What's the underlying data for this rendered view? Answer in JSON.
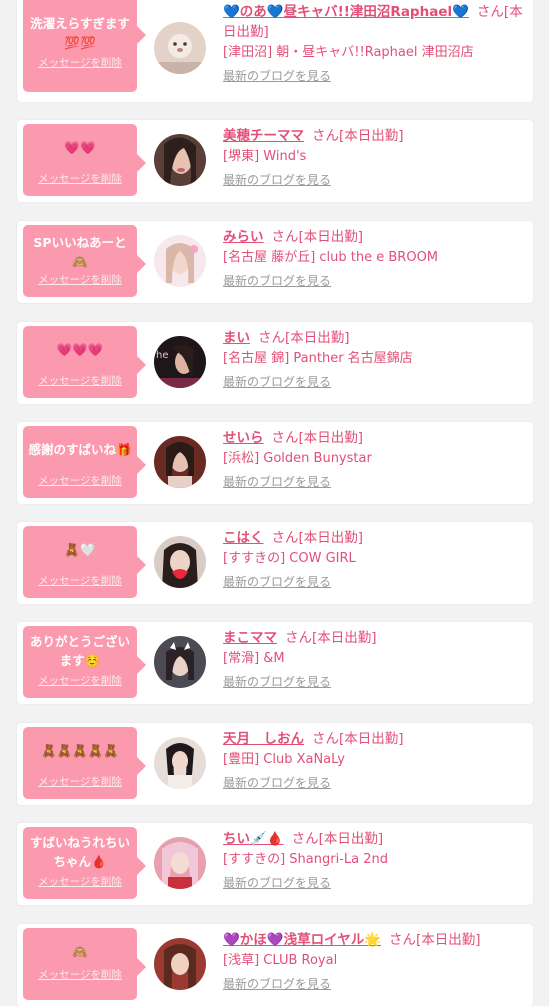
{
  "entries": [
    {
      "message": "洗濯えらすぎます💯💯",
      "delete_label": "メッセージを削除",
      "name": "💙のあ💙昼キャバ!!津田沼Raphael💙",
      "suffix": "さん[本日出勤]",
      "shop": "[津田沼] 朝・昼キャバ!!Raphael 津田沼店",
      "blog_link": "最新のブログを見る",
      "avatar_color": "#d9c6bc"
    },
    {
      "message": "💗💗",
      "delete_label": "メッセージを削除",
      "name": "美穂チーママ",
      "suffix": "さん[本日出勤]",
      "shop": "[堺東] Wind's",
      "blog_link": "最新のブログを見る",
      "avatar_color": "#8a6a5c"
    },
    {
      "message": "SPいいねあーと🙈",
      "delete_label": "メッセージを削除",
      "name": "みらい",
      "suffix": "さん[本日出勤]",
      "shop": "[名古屋 藤が丘] club the e BROOM",
      "blog_link": "最新のブログを見る",
      "avatar_color": "#f3dfe6"
    },
    {
      "message": "💗💗💗",
      "delete_label": "メッセージを削除",
      "name": "まい",
      "suffix": "さん[本日出勤]",
      "shop": "[名古屋 錦] Panther 名古屋錦店",
      "blog_link": "最新のブログを見る",
      "avatar_color": "#3a2a2e"
    },
    {
      "message": "感謝のすばいね🎁",
      "delete_label": "メッセージを削除",
      "name": "せいら",
      "suffix": "さん[本日出勤]",
      "shop": "[浜松] Golden Bunystar",
      "blog_link": "最新のブログを見る",
      "avatar_color": "#7a3a30"
    },
    {
      "message": "🧸🤍",
      "delete_label": "メッセージを削除",
      "name": "こはく",
      "suffix": "さん[本日出勤]",
      "shop": "[すすきの] COW GIRL",
      "blog_link": "最新のブログを見る",
      "avatar_color": "#4a3a34"
    },
    {
      "message": "ありがとうございます☺️",
      "delete_label": "メッセージを削除",
      "name": "まこママ",
      "suffix": "さん[本日出勤]",
      "shop": "[常滑] &M",
      "blog_link": "最新のブログを見る",
      "avatar_color": "#5b5660"
    },
    {
      "message": "🧸🧸🧸🧸🧸",
      "delete_label": "メッセージを削除",
      "name": "天月　しおん",
      "suffix": "さん[本日出勤]",
      "shop": "[豊田] Club XaNaLy",
      "blog_link": "最新のブログを見る",
      "avatar_color": "#d8ccc8"
    },
    {
      "message": "すばいねうれちいちゃん🩸",
      "delete_label": "メッセージを削除",
      "name": "ちい💉🩸",
      "suffix": "さん[本日出勤]",
      "shop": "[すすきの] Shangri-La 2nd",
      "blog_link": "最新のブログを見る",
      "avatar_color": "#d98a9a"
    },
    {
      "message": "🙈",
      "delete_label": "メッセージを削除",
      "name": "💜かほ💜浅草ロイヤル🌟",
      "suffix": "さん[本日出勤]",
      "shop": "[浅草] CLUB Royal",
      "blog_link": "最新のブログを見る",
      "avatar_color": "#b86a5a"
    }
  ]
}
